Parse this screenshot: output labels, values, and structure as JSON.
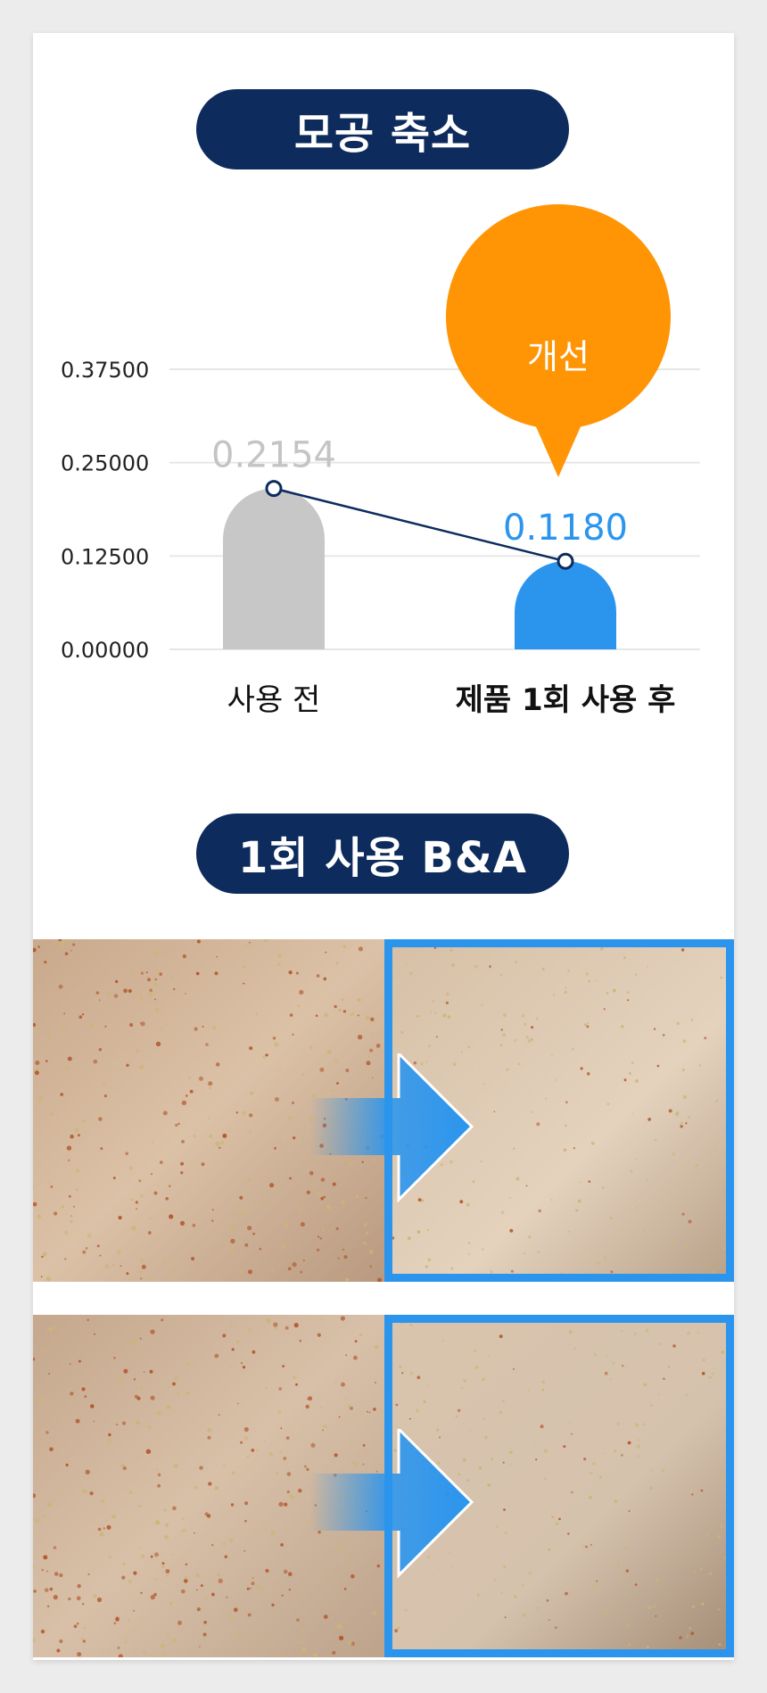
{
  "header_title": "모공 축소",
  "chart_data": {
    "type": "bar",
    "categories": [
      "사용 전",
      "제품 1회 사용 후"
    ],
    "values": [
      0.2154,
      0.118
    ],
    "value_labels": [
      "0.2154",
      "0.1180"
    ],
    "y_ticks": [
      "0.00000",
      "0.12500",
      "0.25000",
      "0.37500"
    ],
    "ylim": [
      0,
      0.375
    ],
    "callout": "개선",
    "colors": {
      "before": "#c7c7c7",
      "after": "#2b95ee",
      "line": "#0d2b5c",
      "callout": "#ff9505"
    }
  },
  "section2_title": "1회 사용 B&A"
}
